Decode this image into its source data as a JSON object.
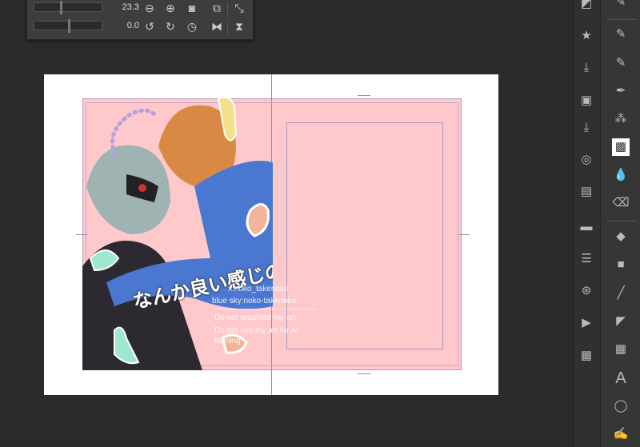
{
  "navigator": {
    "zoom_value": "23.3",
    "rotation_value": "0.0",
    "buttons": [
      "zoom-out",
      "zoom-in",
      "fit",
      "fit-window",
      "fit-width",
      "rotate-left",
      "rotate-right",
      "reset-rotation",
      "flip-horizontal",
      "flip-vertical"
    ]
  },
  "artwork": {
    "title_lettering": "なんか良い感じのタイトル",
    "watermark": {
      "x_handle": "x:noko_takenoko",
      "bluesky_handle": "blue sky:noko-takenoko",
      "rule1": "Do not reupload my art",
      "rule2": "Do not use my art for AI training"
    }
  },
  "colors": {
    "background": "#2b2b2b",
    "paper_pink": "#ffc8cb",
    "guide": "#8f86c4",
    "jacket_blue": "#4a78d0"
  },
  "left_palette": [
    "materials-icon",
    "favorite-folder-icon",
    "download-folder-icon",
    "image-folder-icon",
    "import-folder-icon",
    "layer-property-icon",
    "animation-timeline-icon",
    "layer-icon",
    "sub-tool-detail-icon",
    "navigator-icon",
    "animation-icon",
    "color-set-icon"
  ],
  "tools": [
    "pen",
    "pencil",
    "marker",
    "ink-pen",
    "airbrush",
    "tone",
    "blend",
    "eraser",
    "fill",
    "gradient",
    "line",
    "ruler",
    "frame",
    "text",
    "balloon",
    "correct-line"
  ]
}
